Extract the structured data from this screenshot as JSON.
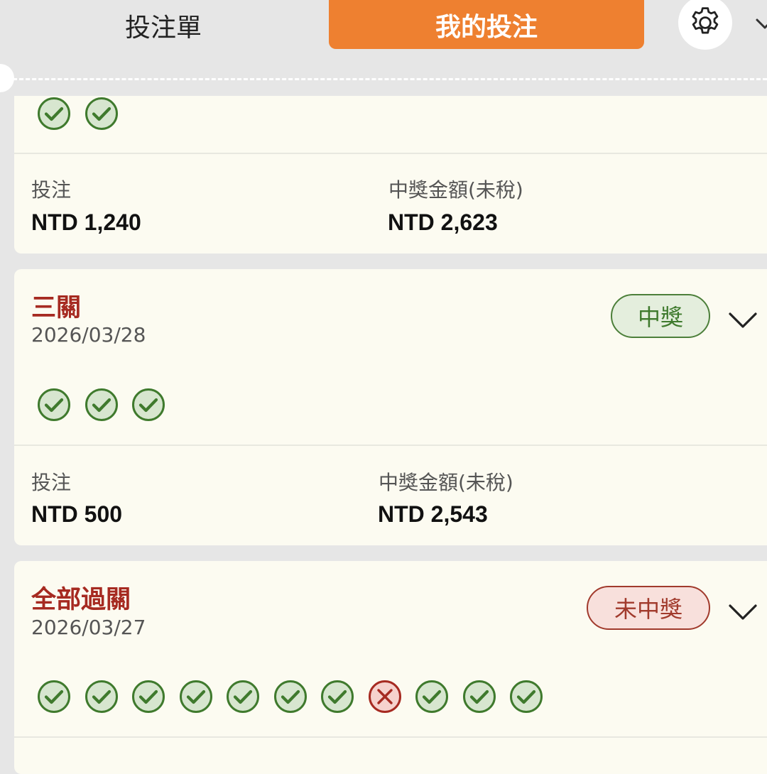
{
  "header": {
    "tab_betslip": "投注單",
    "tab_mybets": "我的投注"
  },
  "bets": [
    {
      "legs": [
        "win",
        "win"
      ],
      "stake_label": "投注",
      "stake": "NTD 1,240",
      "payout_label": "中獎金額(未稅)",
      "payout": "NTD 2,623"
    },
    {
      "title": "三關",
      "date": "2026/03/28",
      "status": "中獎",
      "legs": [
        "win",
        "win",
        "win"
      ],
      "stake_label": "投注",
      "stake": "NTD 500",
      "payout_label": "中獎金額(未稅)",
      "payout": "NTD 2,543"
    },
    {
      "title": "全部過關",
      "date": "2026/03/27",
      "status": "未中獎",
      "legs": [
        "win",
        "win",
        "win",
        "win",
        "win",
        "win",
        "win",
        "lose",
        "win",
        "win",
        "win"
      ]
    }
  ],
  "icons": {
    "settings": "gear-icon",
    "expand": "chevron-down-icon",
    "leg_win": "check-circle-icon",
    "leg_lose": "x-circle-icon"
  },
  "colors": {
    "accent": "#ee8030",
    "win": "#3f7a2d",
    "lose": "#a62a21"
  }
}
